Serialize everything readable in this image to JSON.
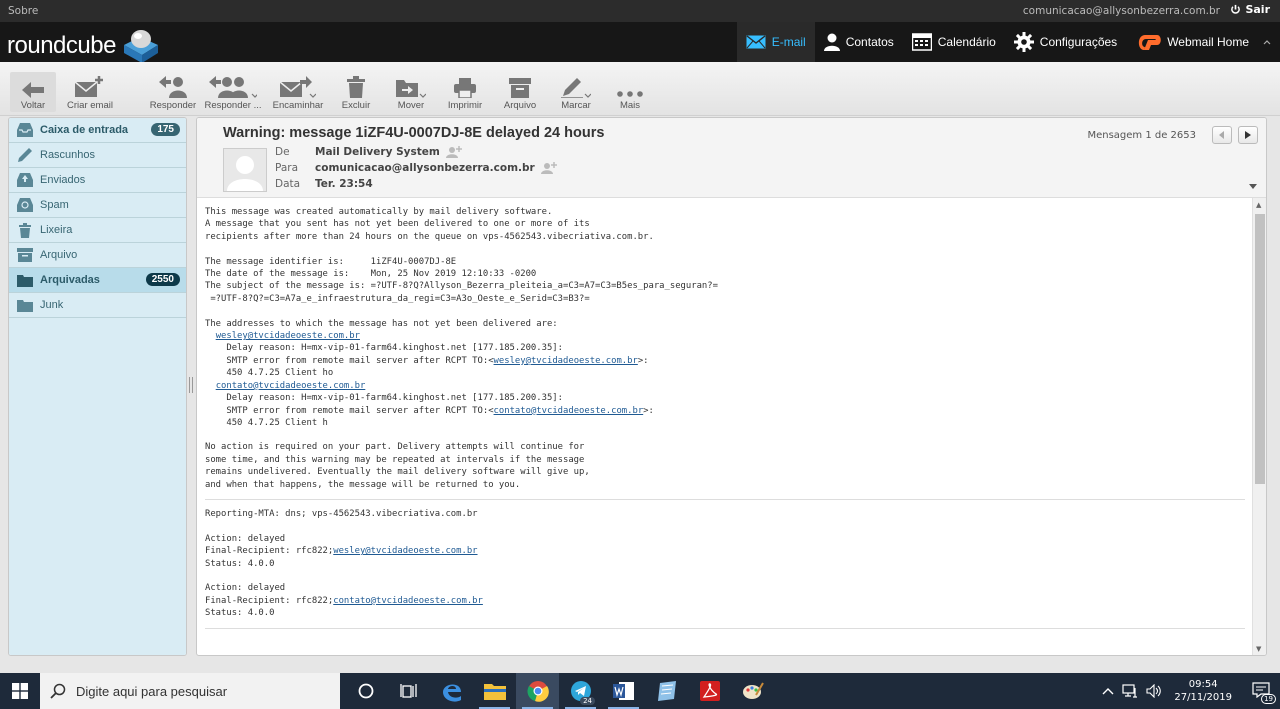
{
  "topbar": {
    "about": "Sobre",
    "user_email": "comunicacao@allysonbezerra.com.br",
    "logout": "Sair"
  },
  "header": {
    "logo_text": "roundcube",
    "nav": [
      {
        "label": "E-mail",
        "icon": "mail-icon",
        "active": true
      },
      {
        "label": "Contatos",
        "icon": "person-icon"
      },
      {
        "label": "Calendário",
        "icon": "calendar-icon"
      },
      {
        "label": "Configurações",
        "icon": "gear-icon"
      },
      {
        "label": "Webmail Home",
        "icon": "cpanel-icon"
      }
    ]
  },
  "toolbar": {
    "back": "Voltar",
    "compose": "Criar email",
    "reply": "Responder",
    "reply_all": "Responder ...",
    "forward": "Encaminhar",
    "delete": "Excluir",
    "move": "Mover",
    "print": "Imprimir",
    "archive": "Arquivo",
    "mark": "Marcar",
    "more": "Mais"
  },
  "folders": [
    {
      "name": "Caixa de entrada",
      "count": "175",
      "icon": "inbox-icon",
      "bold": true
    },
    {
      "name": "Rascunhos",
      "icon": "pencil-icon"
    },
    {
      "name": "Enviados",
      "icon": "sent-icon"
    },
    {
      "name": "Spam",
      "icon": "spam-icon"
    },
    {
      "name": "Lixeira",
      "icon": "trash-icon"
    },
    {
      "name": "Arquivo",
      "icon": "archive-icon"
    },
    {
      "name": "Arquivadas",
      "count": "2550",
      "icon": "folder-icon",
      "bold": true,
      "selected": true
    },
    {
      "name": "Junk",
      "icon": "folder-icon"
    }
  ],
  "message": {
    "subject": "Warning: message 1iZF4U-0007DJ-8E delayed 24 hours",
    "counter": "Mensagem 1 de 2653",
    "from_label": "De",
    "from": "Mail Delivery System",
    "to_label": "Para",
    "to": "comunicacao@allysonbezerra.com.br",
    "date_label": "Data",
    "date": "Ter. 23:54",
    "body_part1": "This message was created automatically by mail delivery software.\nA message that you sent has not yet been delivered to one or more of its\nrecipients after more than 24 hours on the queue on vps-4562543.vibecriativa.com.br.\n\nThe message identifier is:     1iZF4U-0007DJ-8E\nThe date of the message is:    Mon, 25 Nov 2019 12:10:33 -0200\nThe subject of the message is: =?UTF-8?Q?Allyson_Bezerra_pleiteia_a=C3=A7=C3=B5es_para_seguran?=\n =?UTF-8?Q?=C3=A7a_e_infraestrutura_da_regi=C3=A3o_Oeste_e_Serid=C3=B3?=\n\nThe addresses to which the message has not yet been delivered are:\n",
    "recipient1": "wesley@tvcidadeoeste.com.br",
    "delay_reason1": "    Delay reason: H=mx-vip-01-farm64.kinghost.net [177.185.200.35]:",
    "smtp_prefix": "    SMTP error from remote mail server after RCPT TO:<",
    "smtp_suffix": ">:",
    "code1": "    450 4.7.25 Client ho",
    "recipient2": "contato@tvcidadeoeste.com.br",
    "delay_reason2": "    Delay reason: H=mx-vip-01-farm64.kinghost.net [177.185.200.35]:",
    "code2": "    450 4.7.25 Client h",
    "body_part2": "No action is required on your part. Delivery attempts will continue for\nsome time, and this warning may be repeated at intervals if the message\nremains undelivered. Eventually the mail delivery software will give up,\nand when that happens, the message will be returned to you.",
    "reporting_mta": "Reporting-MTA: dns; vps-4562543.vibecriativa.com.br",
    "action": "Action: delayed",
    "final_recipient_prefix": "Final-Recipient: rfc822;",
    "status": "Status: 4.0.0"
  },
  "taskbar": {
    "search_placeholder": "Digite aqui para pesquisar",
    "time": "09:54",
    "date": "27/11/2019",
    "notifications": "19",
    "telegram_badge": "24"
  }
}
